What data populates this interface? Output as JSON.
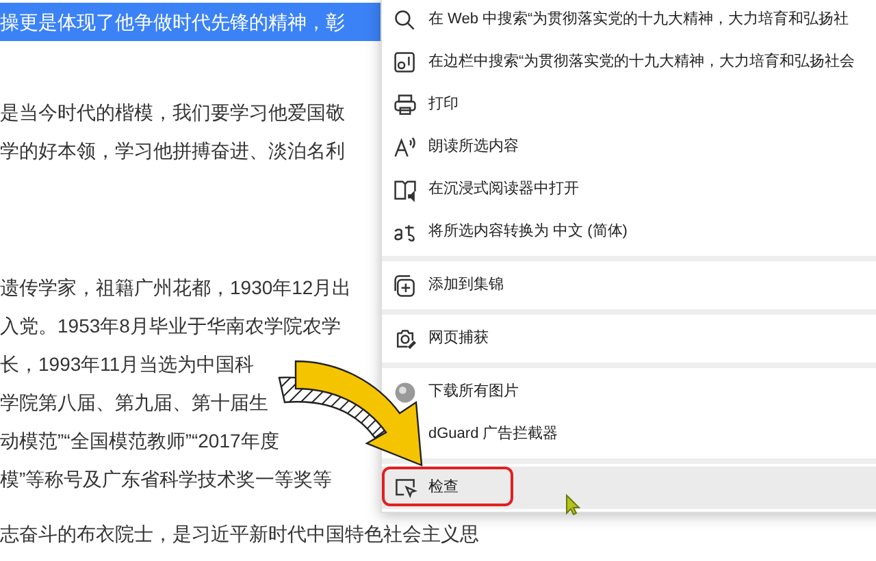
{
  "article": {
    "lines": [
      {
        "text": "操更是体现了他争做时代先锋的精神，彰",
        "selected": true
      },
      {
        "text": "是当今时代的楷模，我们要学习他爱国敬",
        "selected": false
      },
      {
        "text": "学的好本领，学习他拼搏奋进、淡泊名利",
        "selected": false
      },
      {
        "text": "遗传学家，祖籍广州花都，1930年12月出",
        "selected": false
      },
      {
        "text": "入党。1953年8月毕业于华南农学院农学",
        "selected": false
      },
      {
        "text": "长，1993年11月当选为中国科",
        "selected": false
      },
      {
        "text": "学院第八届、第九届、第十届生",
        "selected": false
      },
      {
        "text": "动模范”“全国模范教师”“2017年度",
        "selected": false
      },
      {
        "text": "模”等称号及广东省科学技术奖一等奖等",
        "selected": false
      },
      {
        "text": "志奋斗的布衣院士，是习近平新时代中国特色社会主义思",
        "selected": false
      }
    ]
  },
  "context_menu": {
    "items": [
      {
        "kind": "item",
        "label": "在 Web 中搜索“为贯彻落实党的十九大精神，大力培育和弘扬社",
        "selected": false
      },
      {
        "kind": "item",
        "label": "在边栏中搜索“为贯彻落实党的十九大精神，大力培育和弘扬社会",
        "selected": false
      },
      {
        "kind": "item",
        "label": "打印",
        "selected": false
      },
      {
        "kind": "item",
        "label": "朗读所选内容",
        "selected": false
      },
      {
        "kind": "item",
        "label": "在沉浸式阅读器中打开",
        "selected": false
      },
      {
        "kind": "item",
        "label": "将所选内容转换为 中文 (简体)",
        "selected": false
      },
      {
        "kind": "separator"
      },
      {
        "kind": "item",
        "label": "添加到集锦",
        "selected": false
      },
      {
        "kind": "separator"
      },
      {
        "kind": "item",
        "label": "网页捕获",
        "selected": false
      },
      {
        "kind": "separator"
      },
      {
        "kind": "item",
        "label": "下载所有图片",
        "selected": false
      },
      {
        "kind": "item",
        "label": "dGuard 广告拦截器",
        "selected": false
      },
      {
        "kind": "separator"
      },
      {
        "kind": "item",
        "label": "检查",
        "selected": true
      }
    ]
  }
}
